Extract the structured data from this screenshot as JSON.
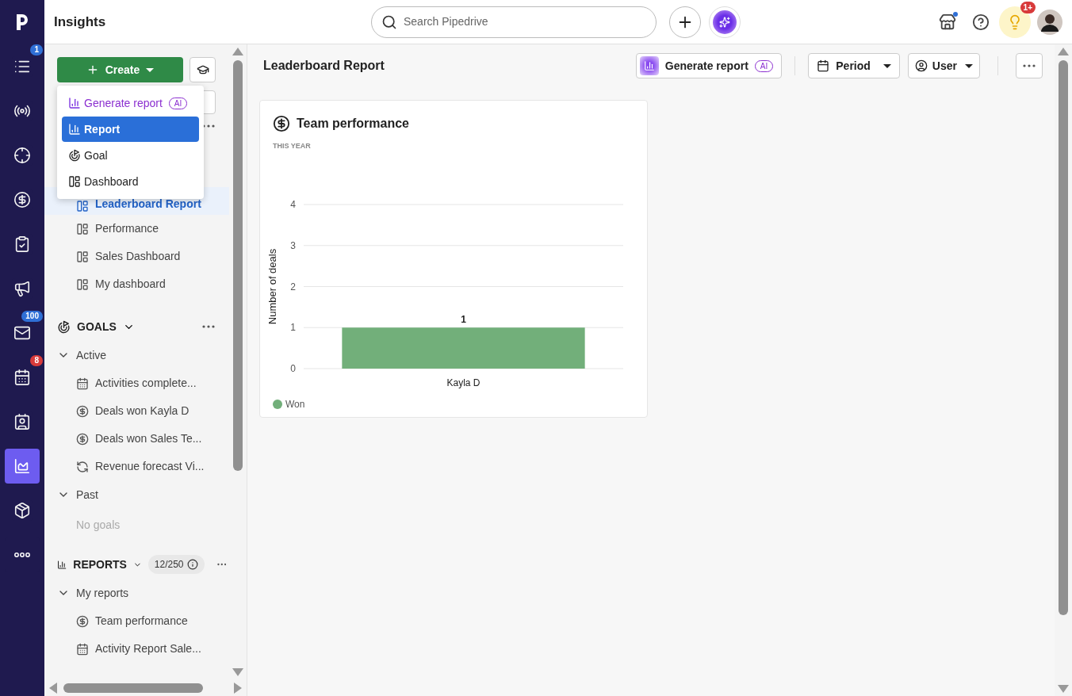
{
  "app_title": "Insights",
  "nav": [
    {
      "kind": "logo"
    },
    {
      "kind": "list",
      "badge": "1",
      "selected": false
    },
    {
      "kind": "radio",
      "selected": false
    },
    {
      "kind": "target",
      "selected": false
    },
    {
      "kind": "dollar",
      "selected": false
    },
    {
      "kind": "clipboard",
      "selected": false
    },
    {
      "kind": "megaphone",
      "selected": false
    },
    {
      "kind": "mail",
      "badge": "100",
      "selected": false
    },
    {
      "kind": "calendar",
      "badge": "8",
      "selected": false
    },
    {
      "kind": "contact",
      "selected": false
    },
    {
      "kind": "insights",
      "selected": true
    },
    {
      "kind": "box",
      "selected": false
    },
    {
      "kind": "more",
      "selected": false
    }
  ],
  "search": {
    "placeholder": "Search Pipedrive"
  },
  "notifications_badge": "1+",
  "create_button": "Create",
  "create_menu": [
    {
      "kind": "ai",
      "label": "Generate report",
      "tag": "AI",
      "selected": false
    },
    {
      "kind": "report",
      "label": "Report",
      "selected": true
    },
    {
      "kind": "goal",
      "label": "Goal",
      "selected": false
    },
    {
      "kind": "dashboard",
      "label": "Dashboard",
      "selected": false
    }
  ],
  "dashboards": [
    {
      "label": "Leaderboard Report",
      "selected": true
    },
    {
      "label": "Performance",
      "selected": false
    },
    {
      "label": "Sales Dashboard",
      "selected": false
    },
    {
      "label": "My dashboard",
      "selected": false
    }
  ],
  "goals": {
    "title": "GOALS",
    "groups": [
      {
        "label": "Active",
        "expanded": true,
        "items": [
          {
            "kind": "calendar",
            "label": "Activities complete..."
          },
          {
            "kind": "dollar",
            "label": "Deals won Kayla D"
          },
          {
            "kind": "dollar",
            "label": "Deals won Sales Te..."
          },
          {
            "kind": "forecast",
            "label": "Revenue forecast Vi..."
          }
        ]
      },
      {
        "label": "Past",
        "expanded": true,
        "empty_text": "No goals"
      }
    ]
  },
  "reports": {
    "title": "REPORTS",
    "count": "12/250",
    "groups": [
      {
        "label": "My reports",
        "expanded": true,
        "items": [
          {
            "kind": "dollar",
            "label": "Team performance"
          },
          {
            "kind": "calendar",
            "label": "Activity Report Sale..."
          }
        ]
      }
    ]
  },
  "page_title": "Leaderboard Report",
  "toolbar": {
    "generate": "Generate report",
    "generate_tag": "AI",
    "period": "Period",
    "user": "User"
  },
  "card": {
    "title": "Team performance",
    "subtitle": "THIS YEAR",
    "chart_data": {
      "type": "bar",
      "ylabel": "Number of deals",
      "categories": [
        "Kayla D"
      ],
      "series": [
        {
          "name": "Won",
          "color": "#72af7a",
          "values": [
            1
          ]
        }
      ],
      "ylim": [
        0,
        4
      ],
      "yticks": [
        0,
        1,
        2,
        3,
        4
      ],
      "grid": true,
      "data_labels": true
    }
  }
}
